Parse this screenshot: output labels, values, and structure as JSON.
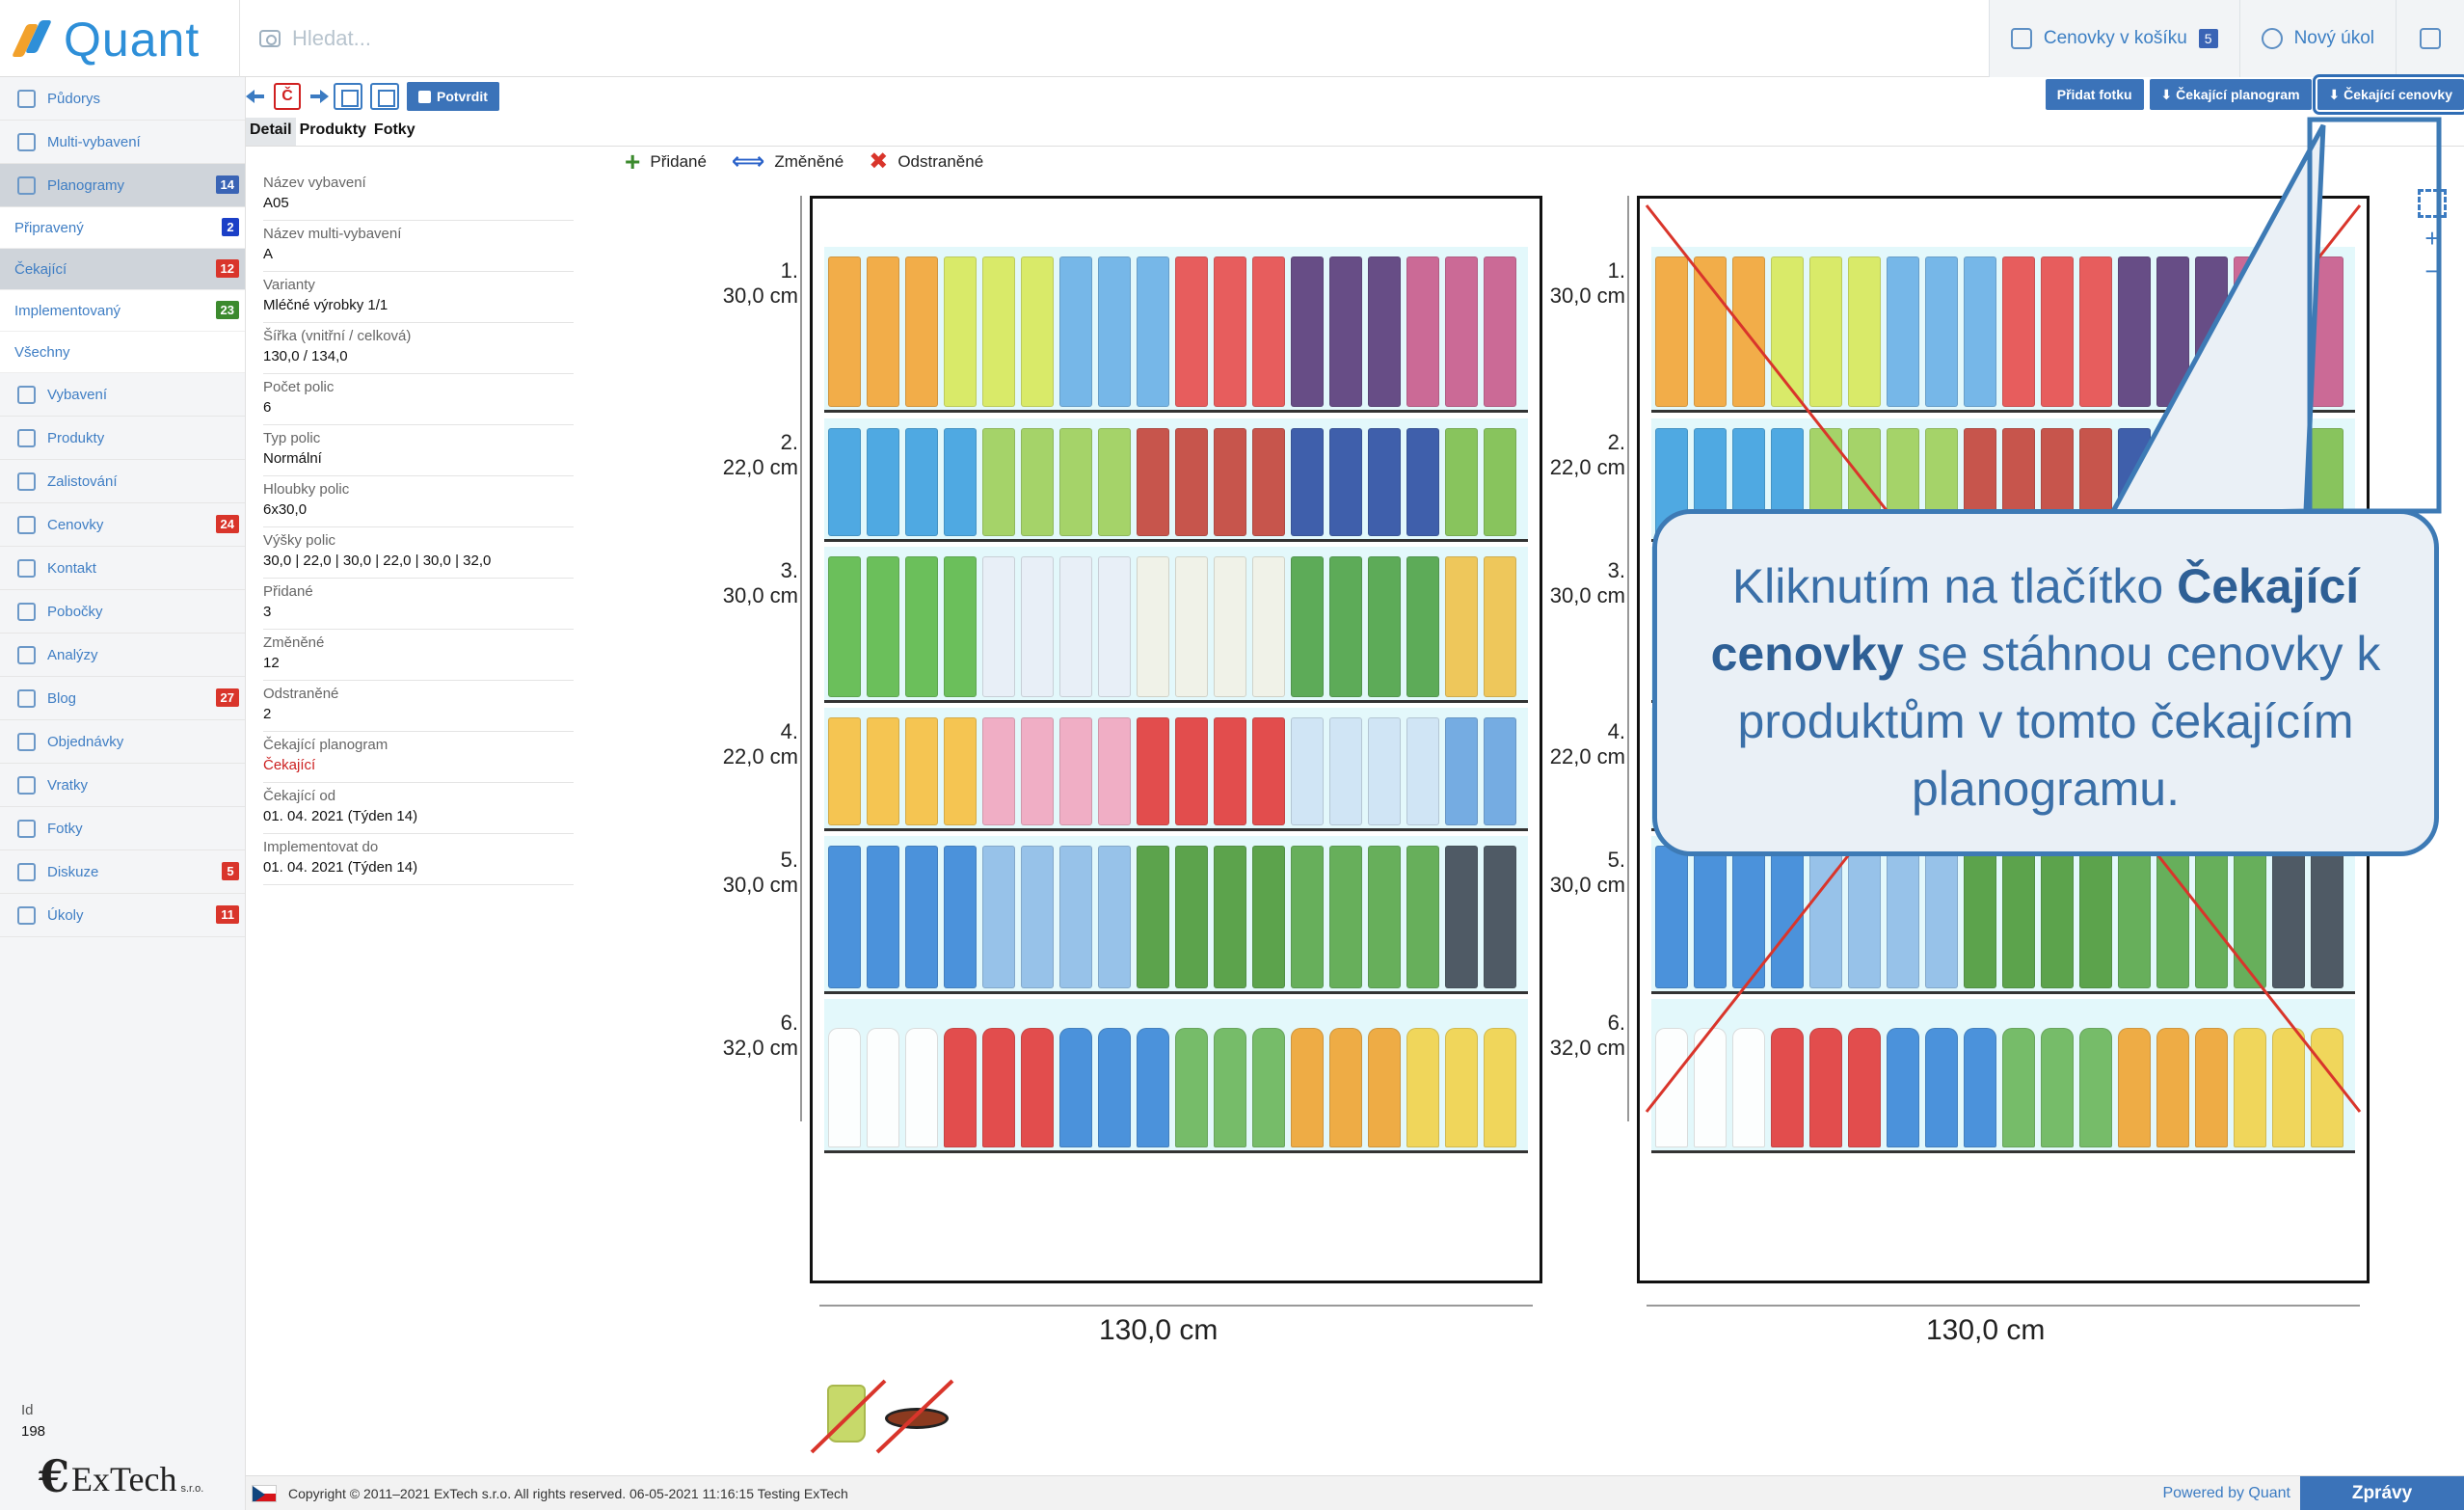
{
  "app": {
    "logo": "Quant",
    "search_placeholder": "Hledat...",
    "top_actions": [
      {
        "label": "Cenovky v košíku",
        "badge": "5"
      },
      {
        "label": "Nový úkol"
      }
    ]
  },
  "sidebar": {
    "items": [
      {
        "label": "Půdorys"
      },
      {
        "label": "Multi-vybavení"
      },
      {
        "label": "Planogramy",
        "count": "14",
        "count_color": "#3a64b5",
        "active": true
      },
      {
        "label": "Vybavení"
      },
      {
        "label": "Produkty"
      },
      {
        "label": "Zalistování"
      },
      {
        "label": "Cenovky",
        "count": "24",
        "count_color": "#d9352b"
      },
      {
        "label": "Kontakt"
      },
      {
        "label": "Pobočky"
      },
      {
        "label": "Analýzy"
      },
      {
        "label": "Blog",
        "count": "27",
        "count_color": "#d9352b"
      },
      {
        "label": "Objednávky"
      },
      {
        "label": "Vratky"
      },
      {
        "label": "Fotky"
      },
      {
        "label": "Diskuze",
        "count": "5",
        "count_color": "#d9352b"
      },
      {
        "label": "Úkoly",
        "count": "11",
        "count_color": "#d9352b"
      }
    ],
    "sub_items": [
      {
        "label": "Připravený",
        "count": "2",
        "count_color": "#1b3fc7"
      },
      {
        "label": "Čekající",
        "count": "12",
        "count_color": "#d9352b",
        "active": true
      },
      {
        "label": "Implementovaný",
        "count": "23",
        "count_color": "#3c8a2e"
      },
      {
        "label": "Všechny"
      }
    ],
    "id_label": "Id",
    "id_value": "198",
    "company": "ExTech",
    "company_suffix": "s.r.o."
  },
  "toolbar": {
    "c_label": "Č",
    "confirm": "Potvrdit",
    "add_photo": "Přidat fotku",
    "pending_planogram": "⬇ Čekající planogram",
    "pending_labels": "⬇ Čekající cenovky"
  },
  "tabs": [
    "Detail",
    "Produkty",
    "Fotky"
  ],
  "details": [
    {
      "label": "Název vybavení",
      "value": "A05"
    },
    {
      "label": "Název multi-vybavení",
      "value": "A"
    },
    {
      "label": "Varianty",
      "value": "Mléčné výrobky 1/1"
    },
    {
      "label": "Šířka (vnitřní / celková)",
      "value": "130,0 / 134,0"
    },
    {
      "label": "Počet polic",
      "value": "6"
    },
    {
      "label": "Typ polic",
      "value": "Normální"
    },
    {
      "label": "Hloubky polic",
      "value": "6x30,0"
    },
    {
      "label": "Výšky polic",
      "value": "30,0 | 22,0 | 30,0 | 22,0 | 30,0 | 32,0"
    },
    {
      "label": "Přidané",
      "value": "3"
    },
    {
      "label": "Změněné",
      "value": "12"
    },
    {
      "label": "Odstraněné",
      "value": "2"
    },
    {
      "label": "Čekající planogram",
      "value": "Čekající",
      "red": true
    },
    {
      "label": "Čekající od",
      "value": "01. 04. 2021 (Týden 14)"
    },
    {
      "label": "Implementovat do",
      "value": "01. 04. 2021 (Týden 14)"
    }
  ],
  "legend": {
    "added": "Přidané",
    "changed": "Změněné",
    "removed": "Odstraněné"
  },
  "shelves": [
    {
      "num": "1.",
      "height": "30,0 cm"
    },
    {
      "num": "2.",
      "height": "22,0 cm"
    },
    {
      "num": "3.",
      "height": "30,0 cm"
    },
    {
      "num": "4.",
      "height": "22,0 cm"
    },
    {
      "num": "5.",
      "height": "30,0 cm"
    },
    {
      "num": "6.",
      "height": "32,0 cm"
    }
  ],
  "width_label": "130,0 cm",
  "callout": {
    "part1": "Kliknutím na tlačítko ",
    "bold": "Čekající cenovky",
    "part2": " se stáhnou cenovky k produktům v tomto čekajícím planogramu."
  },
  "footer": {
    "copyright": "Copyright © 2011–2021 ExTech s.r.o. All rights reserved. 06-05-2021 11:16:15   Testing ExTech",
    "powered": "Powered by Quant",
    "messages": "Zprávy"
  },
  "colors": {
    "accent": "#3b73b9",
    "shelf_bg": "#e3f8fb",
    "alert_red": "#d9352b"
  }
}
